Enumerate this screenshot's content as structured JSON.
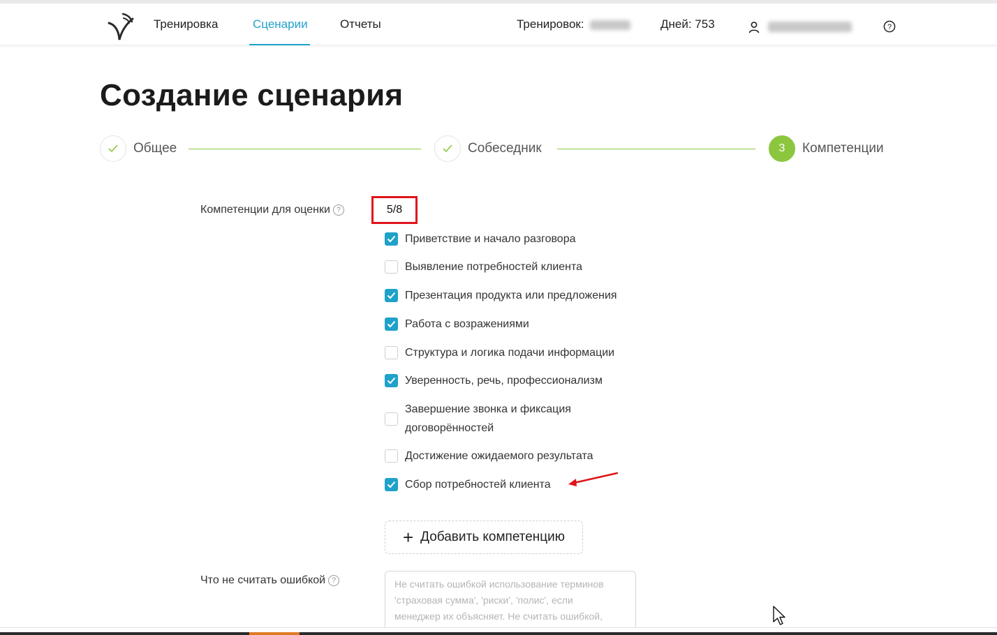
{
  "header": {
    "nav": [
      {
        "label": "Тренировка"
      },
      {
        "label": "Сценарии"
      },
      {
        "label": "Отчеты"
      }
    ],
    "trainings_label": "Тренировок:",
    "days_label": "Дней: 753"
  },
  "page": {
    "title": "Создание сценария"
  },
  "steps": [
    {
      "label": "Общее"
    },
    {
      "label": "Собеседник"
    },
    {
      "number": "3",
      "label": "Компетенции"
    }
  ],
  "competencies": {
    "label": "Компетенции для оценки",
    "counter": "5/8",
    "items": [
      {
        "label": "Приветствие и начало разговора",
        "checked": true
      },
      {
        "label": "Выявление потребностей клиента",
        "checked": false
      },
      {
        "label": "Презентация продукта или предложения",
        "checked": true
      },
      {
        "label": "Работа с возражениями",
        "checked": true
      },
      {
        "label": "Структура и логика подачи информации",
        "checked": false
      },
      {
        "label": "Уверенность, речь, профессионализм",
        "checked": true
      },
      {
        "label_line1": "Завершение звонка и фиксация",
        "label_line2": "договорённостей",
        "checked": false
      },
      {
        "label": "Достижение ожидаемого результата",
        "checked": false
      },
      {
        "label": "Сбор потребностей клиента",
        "checked": true
      }
    ],
    "add_button": "Добавить компетенцию"
  },
  "not_error": {
    "label": "Что не считать ошибкой",
    "placeholder_line1": "Не считать ошибкой использование терминов",
    "placeholder_line2": "'страховая сумма', 'риски', 'полис', если",
    "placeholder_line3": "менеджер их объясняет. Не считать ошибкой,"
  },
  "colors": {
    "accent_blue": "#1fa2c9",
    "step_green": "#8cc63f",
    "highlight_red": "#e0141b"
  }
}
